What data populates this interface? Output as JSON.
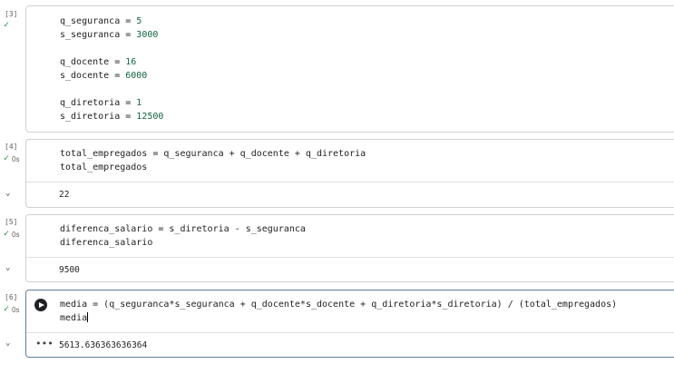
{
  "cells": [
    {
      "exec_count": "[3]",
      "lines": [
        {
          "name": "q_seguranca",
          "op": " = ",
          "value": "5"
        },
        {
          "name": "s_seguranca",
          "op": " = ",
          "value": "3000"
        },
        {
          "name": "q_docente",
          "op": " = ",
          "value": "16"
        },
        {
          "name": "s_docente",
          "op": " = ",
          "value": "6000"
        },
        {
          "name": "q_diretoria",
          "op": " = ",
          "value": "1"
        },
        {
          "name": "s_diretoria",
          "op": " = ",
          "value": "12500"
        }
      ]
    },
    {
      "exec_count": "[4]",
      "time": "0s",
      "line1": "total_empregados = q_seguranca + q_docente + q_diretoria",
      "line2": "total_empregados",
      "output": "22"
    },
    {
      "exec_count": "[5]",
      "time": "0s",
      "line1": "diferenca_salario = s_diretoria - s_seguranca",
      "line2": "diferenca_salario",
      "output": "9500"
    },
    {
      "exec_count": "[6]",
      "time": "0s",
      "line1_a": "media = ",
      "line1_b": "(",
      "line1_c": "q_seguranca*s_seguranca + q_docente*s_docente + q_diretoria*s_diretoria",
      "line1_d": ") / (",
      "line1_e": "total_empregados",
      "line1_f": ")",
      "line2": "media",
      "output": "5613.636363636364"
    }
  ],
  "icons": {
    "check": "✓",
    "chevron": "chevron-down-icon",
    "run": "play-circle-icon",
    "more": "more-horiz-icon"
  },
  "colors": {
    "number": "#116644",
    "success": "#1e8e3e",
    "active_border": "#5f7fa3"
  }
}
